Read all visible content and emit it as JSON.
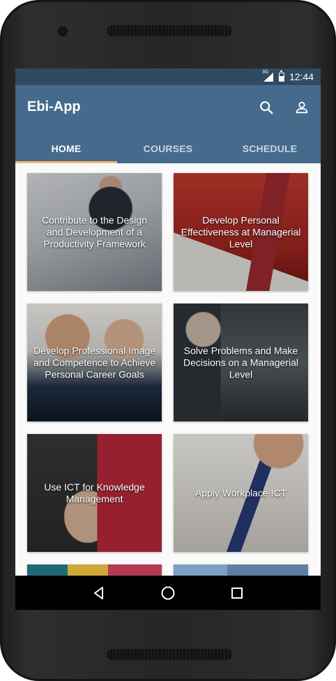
{
  "status_bar": {
    "network": "3G",
    "time": "12:44"
  },
  "app_bar": {
    "title": "Ebi-App",
    "icons": [
      "search-icon",
      "account-icon"
    ]
  },
  "tabs": [
    {
      "label": "HOME",
      "active": true
    },
    {
      "label": "COURSES",
      "active": false
    },
    {
      "label": "SCHEDULE",
      "active": false
    }
  ],
  "courses": [
    {
      "title": "Contribute to the Design and Development of a Productivity Framework"
    },
    {
      "title": "Develop Personal Effectiveness at Managerial Level"
    },
    {
      "title": "Develop Professional Image and Competence to Achieve Personal Career Goals"
    },
    {
      "title": "Solve Problems and Make Decisions on a Managerial Level"
    },
    {
      "title": "Use ICT for Knowledge Management"
    },
    {
      "title": "Apply Workplace ICT"
    }
  ],
  "nav_bar": {
    "icons": [
      "back-icon",
      "home-icon",
      "recents-icon"
    ]
  },
  "colors": {
    "status_bar": "#2f4a61",
    "app_bar": "#456a8c",
    "tab_indicator": "#f5b66a"
  }
}
